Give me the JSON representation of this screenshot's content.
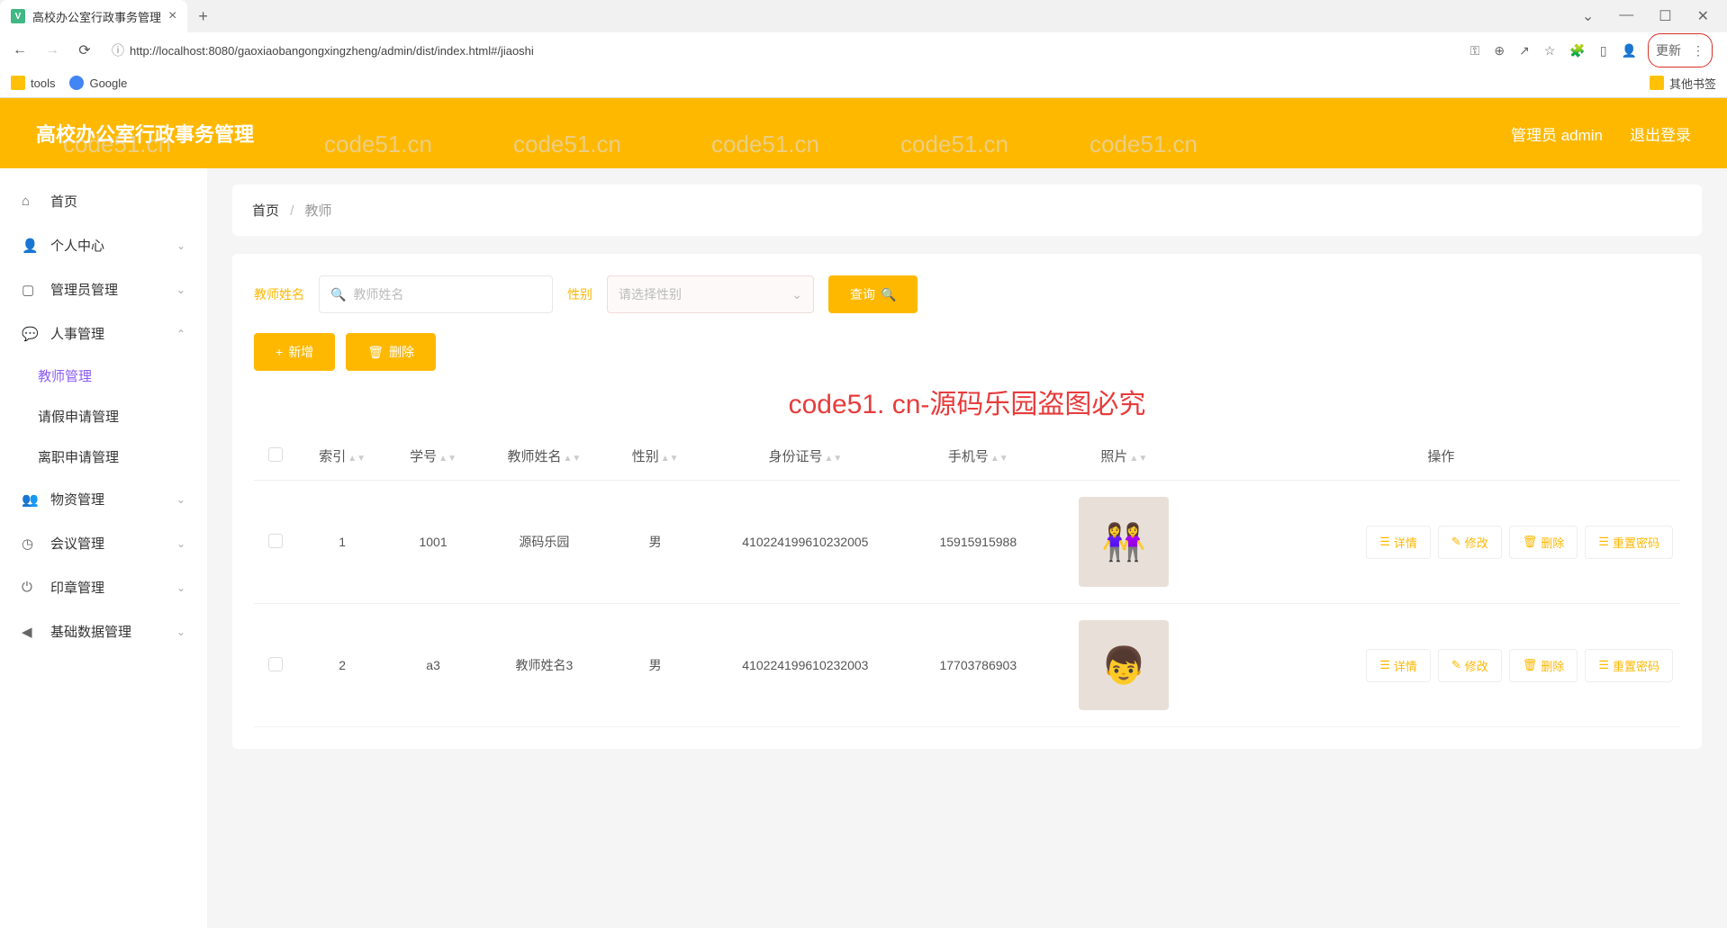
{
  "browser": {
    "tab_title": "高校办公室行政事务管理",
    "url": "http://localhost:8080/gaoxiaobangongxingzheng/admin/dist/index.html#/jiaoshi",
    "update": "更新",
    "bookmarks": {
      "tools": "tools",
      "google": "Google",
      "other": "其他书签"
    }
  },
  "header": {
    "title": "高校办公室行政事务管理",
    "user": "管理员 admin",
    "logout": "退出登录"
  },
  "sidebar": {
    "home": "首页",
    "personal": "个人中心",
    "admin_mgmt": "管理员管理",
    "hr_mgmt": "人事管理",
    "hr_sub": {
      "teacher": "教师管理",
      "leave": "请假申请管理",
      "resign": "离职申请管理"
    },
    "material": "物资管理",
    "meeting": "会议管理",
    "seal": "印章管理",
    "basic": "基础数据管理"
  },
  "breadcrumb": {
    "home": "首页",
    "current": "教师"
  },
  "search": {
    "name_label": "教师姓名",
    "name_placeholder": "教师姓名",
    "gender_label": "性别",
    "gender_placeholder": "请选择性别",
    "query": "查询"
  },
  "actions": {
    "add": "新增",
    "delete": "删除"
  },
  "watermark": "code51. cn-源码乐园盗图必究",
  "table": {
    "headers": {
      "index": "索引",
      "sid": "学号",
      "name": "教师姓名",
      "gender": "性别",
      "idcard": "身份证号",
      "phone": "手机号",
      "photo": "照片",
      "action": "操作"
    },
    "rows": [
      {
        "index": "1",
        "sid": "1001",
        "name": "源码乐园",
        "gender": "男",
        "idcard": "410224199610232005",
        "phone": "15915915988"
      },
      {
        "index": "2",
        "sid": "a3",
        "name": "教师姓名3",
        "gender": "男",
        "idcard": "410224199610232003",
        "phone": "17703786903"
      }
    ],
    "actions": {
      "detail": "详情",
      "edit": "修改",
      "del": "删除",
      "reset": "重置密码"
    }
  }
}
